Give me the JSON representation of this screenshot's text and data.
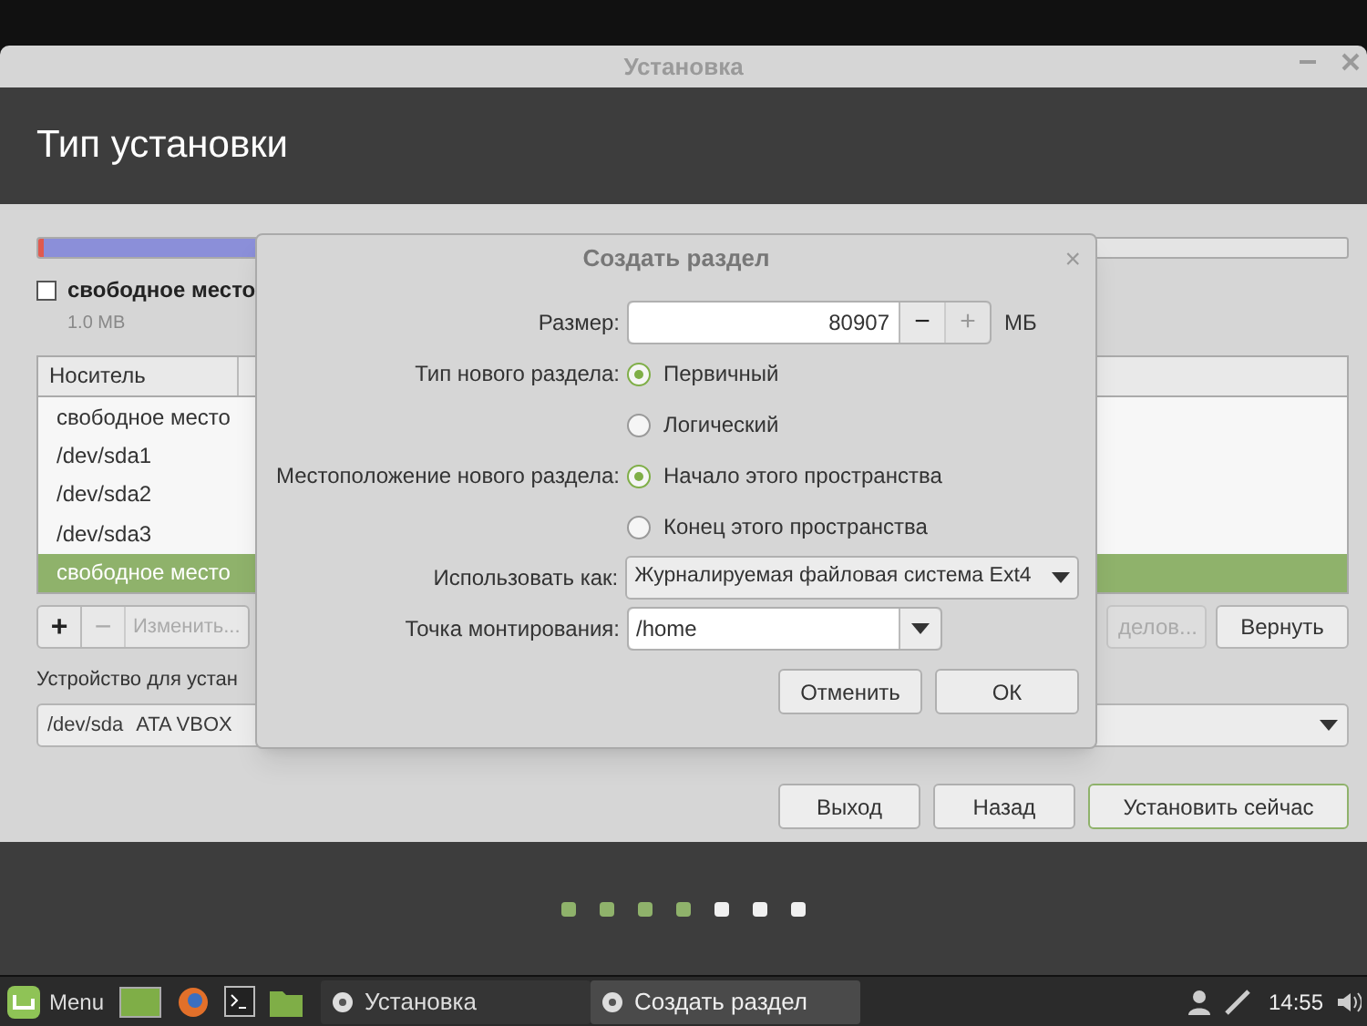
{
  "window": {
    "title": "Установка"
  },
  "header": {
    "title": "Тип установки"
  },
  "legend": {
    "label": "свободное место",
    "size": "1.0 MB"
  },
  "table": {
    "columns": [
      "Носитель"
    ],
    "rows": [
      {
        "cells": [
          "свободное место"
        ],
        "selected": false
      },
      {
        "cells": [
          "/dev/sda1"
        ],
        "selected": false
      },
      {
        "cells": [
          "/dev/sda2"
        ],
        "selected": false
      },
      {
        "cells": [
          "/dev/sda3"
        ],
        "selected": false
      },
      {
        "cells": [
          "свободное место"
        ],
        "selected": true
      }
    ]
  },
  "toolbar": {
    "add": "+",
    "remove": "−",
    "change": "Изменить...",
    "new_table": "делов...",
    "revert": "Вернуть"
  },
  "bootloader": {
    "label": "Устройство для устан",
    "device": "/dev/sda",
    "model": "ATA VBOX"
  },
  "nav_buttons": [
    {
      "label": "Выход",
      "kind": "normal"
    },
    {
      "label": "Назад",
      "kind": "normal"
    },
    {
      "label": "Установить сейчас",
      "kind": "suggested"
    }
  ],
  "progress_dots": [
    {
      "done": true
    },
    {
      "done": true
    },
    {
      "done": true
    },
    {
      "done": true
    },
    {
      "done": false
    },
    {
      "done": false
    },
    {
      "done": false
    }
  ],
  "dialog": {
    "title": "Создать раздел",
    "close": "×",
    "size_label": "Размер:",
    "size_value": "80907",
    "minus": "−",
    "plus": "+",
    "unit": "МБ",
    "type_label": "Тип нового раздела:",
    "type_options": [
      {
        "label": "Первичный",
        "selected": true
      },
      {
        "label": "Логический",
        "selected": false
      }
    ],
    "location_label": "Местоположение нового раздела:",
    "location_options": [
      {
        "label": "Начало этого пространства",
        "selected": true
      },
      {
        "label": "Конец этого пространства",
        "selected": false
      }
    ],
    "use_as_label": "Использовать как:",
    "use_as_value": "Журналируемая файловая система Ext4",
    "mount_label": "Точка монтирования:",
    "mount_value": "/home",
    "buttons": [
      "Отменить",
      "ОК"
    ]
  },
  "taskbar": {
    "menu": "Menu",
    "tasks": [
      {
        "label": "Установка",
        "selected": false
      },
      {
        "label": "Создать раздел",
        "selected": true
      }
    ],
    "clock": "14:55"
  }
}
